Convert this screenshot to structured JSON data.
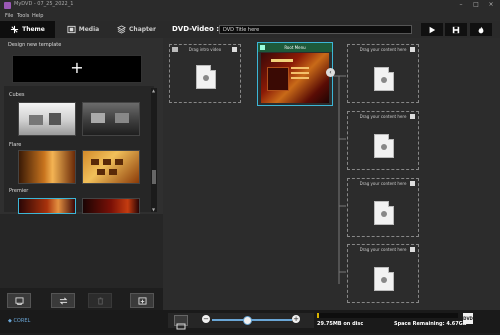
{
  "window": {
    "app_title": "MyDVD - 07_25_2022_1"
  },
  "menu": [
    "File",
    "Tools",
    "Help"
  ],
  "tabs": [
    {
      "label": "Theme",
      "active": true,
      "icon": "theme-icon"
    },
    {
      "label": "Media",
      "active": false,
      "icon": "film-icon"
    },
    {
      "label": "Chapter",
      "active": false,
      "icon": "layers-icon"
    }
  ],
  "left_panel": {
    "design_new_template_label": "Design new template",
    "add_symbol": "+",
    "categories": [
      {
        "name": "Cubes",
        "thumbs": 2
      },
      {
        "name": "Flare",
        "thumbs": 2
      },
      {
        "name": "Premier",
        "thumbs": 2
      }
    ]
  },
  "bottom_tools": [
    "add-template-icon",
    "swap-icon",
    "delete-icon",
    "export-icon"
  ],
  "branding": {
    "logo_text": "COREL"
  },
  "header": {
    "dvd_label": "DVD-Video :",
    "title_value": "DVD Title here",
    "buttons": [
      "play-icon",
      "save-icon",
      "burn-icon"
    ]
  },
  "canvas": {
    "intro_drop_label": "Drag intro video",
    "root_menu_title": "Root Menu",
    "content_drop_label": "Drag your content here",
    "content_drop_count": 4,
    "arrow_symbol": "‹"
  },
  "status": {
    "disc_used": "29.75MB on disc",
    "space_remaining": "Space Remaining: 4.67GB",
    "disc_badge": "DVD",
    "disc_used_fraction": 0.006,
    "zoom_fraction": 0.42,
    "zoom_minus": "−",
    "zoom_plus": "+"
  },
  "colors": {
    "accent": "#3cb6d6",
    "disc_fill": "#d9b400",
    "slider": "#6aa6d6"
  }
}
